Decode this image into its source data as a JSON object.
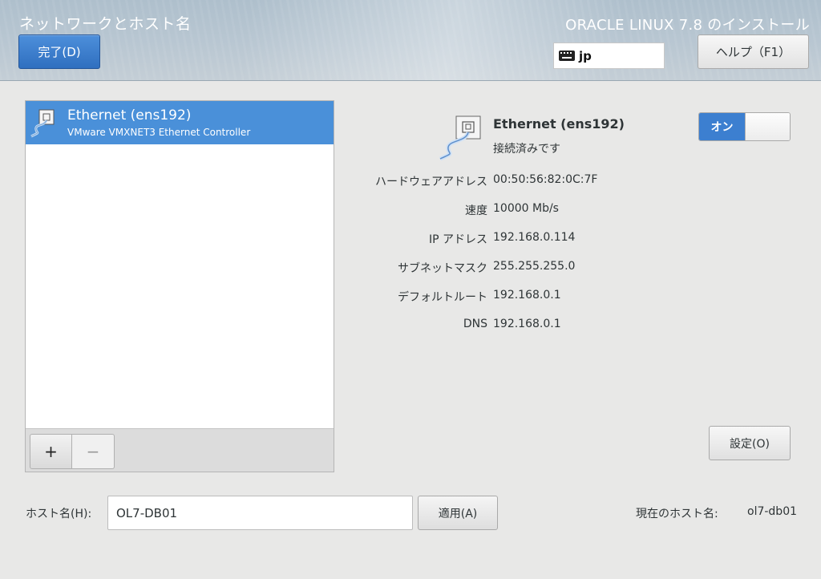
{
  "header": {
    "page_title": "ネットワークとホスト名",
    "done_button": "完了(D)",
    "product_title": "ORACLE LINUX 7.8 のインストール",
    "keyboard_layout": "jp",
    "help_button": "ヘルプ（F1）"
  },
  "devices": [
    {
      "name": "Ethernet (ens192)",
      "description": "VMware VMXNET3 Ethernet Controller",
      "selected": true
    }
  ],
  "list_toolbar": {
    "add_label": "+",
    "remove_label": "−"
  },
  "details": {
    "name": "Ethernet (ens192)",
    "status": "接続済みです",
    "switch_label": "オン",
    "properties": [
      {
        "label": "ハードウェアアドレス",
        "value": "00:50:56:82:0C:7F"
      },
      {
        "label": "速度",
        "value": "10000 Mb/s"
      },
      {
        "label": "IP アドレス",
        "value": "192.168.0.114"
      },
      {
        "label": "サブネットマスク",
        "value": "255.255.255.0"
      },
      {
        "label": "デフォルトルート",
        "value": "192.168.0.1"
      },
      {
        "label": "DNS",
        "value": "192.168.0.1"
      }
    ],
    "settings_button": "設定(O)"
  },
  "hostname": {
    "label": "ホスト名(H):",
    "value": "OL7-DB01",
    "apply_button": "適用(A)",
    "current_label": "現在のホスト名:",
    "current_value": "ol7-db01"
  },
  "colors": {
    "accent": "#4a90d9",
    "primary_button": "#3c7fd0"
  }
}
